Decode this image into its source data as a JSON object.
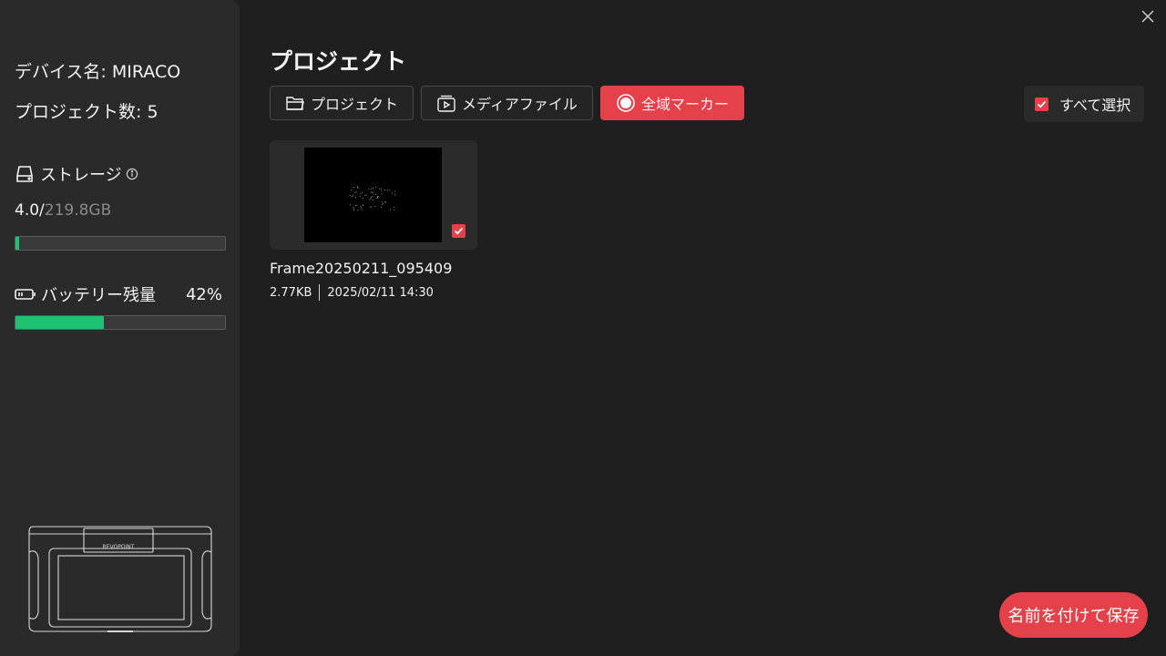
{
  "sidebar": {
    "device_name": "デバイス名: MIRACO",
    "project_count": "プロジェクト数: 5",
    "storage_label": "ストレージ",
    "storage_used": "4.0/",
    "storage_total": "219.8GB",
    "storage_fraction": 0.018,
    "battery_label": "バッテリー残量",
    "battery_percent": "42%",
    "battery_fraction": 0.42,
    "device_brand": "REVOPOINT"
  },
  "header": {
    "title": "プロジェクト"
  },
  "tabs": [
    {
      "label": "プロジェクト",
      "icon": "folder-icon",
      "active": false
    },
    {
      "label": "メディアファイル",
      "icon": "media-file-icon",
      "active": false
    },
    {
      "label": "全域マーカー",
      "icon": "radio-marker-icon",
      "active": true
    }
  ],
  "select_all": {
    "label": "すべて選択",
    "checked": true
  },
  "files": [
    {
      "name": "Frame20250211_095409",
      "size": "2.77KB",
      "date": "2025/02/11 14:30",
      "checked": true
    }
  ],
  "actions": {
    "save_as": "名前を付けて保存"
  },
  "colors": {
    "accent": "#e5414a",
    "progress": "#1ec270",
    "background": "#1f1f1f",
    "sidebar": "#2a2a2a"
  }
}
